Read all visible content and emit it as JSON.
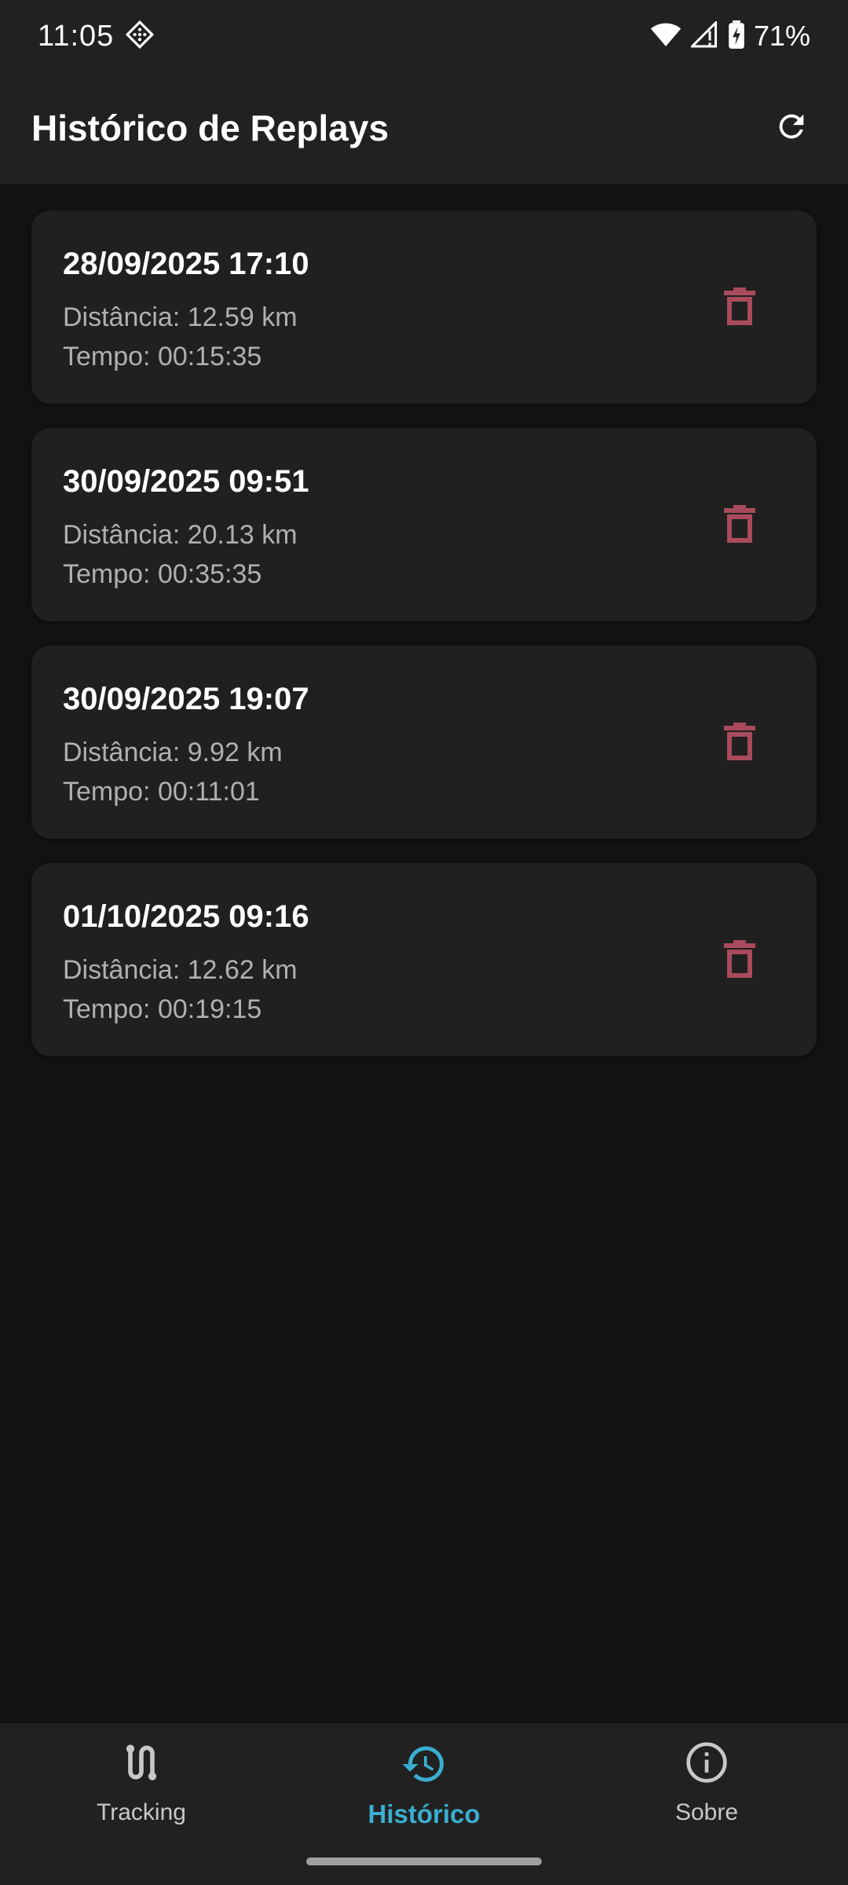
{
  "status_bar": {
    "time": "11:05",
    "battery": "71%"
  },
  "app_bar": {
    "title": "Histórico de Replays"
  },
  "replays": [
    {
      "date": "28/09/2025 17:10",
      "distance": "Distância: 12.59 km",
      "time": "Tempo: 00:15:35"
    },
    {
      "date": "30/09/2025 09:51",
      "distance": "Distância: 20.13 km",
      "time": "Tempo: 00:35:35"
    },
    {
      "date": "30/09/2025 19:07",
      "distance": "Distância: 9.92 km",
      "time": "Tempo: 00:11:01"
    },
    {
      "date": "01/10/2025 09:16",
      "distance": "Distância: 12.62 km",
      "time": "Tempo: 00:19:15"
    }
  ],
  "bottom_nav": {
    "items": [
      {
        "label": "Tracking",
        "icon": "route-icon",
        "active": false
      },
      {
        "label": "Histórico",
        "icon": "history-icon",
        "active": true
      },
      {
        "label": "Sobre",
        "icon": "info-icon",
        "active": false
      }
    ]
  },
  "colors": {
    "background": "#121212",
    "surface": "#202020",
    "accent": "#3aaed0",
    "delete": "#a94b5c"
  }
}
